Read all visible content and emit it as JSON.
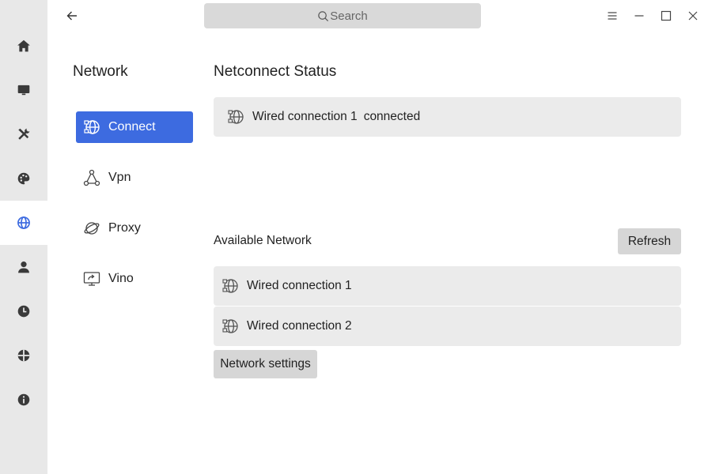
{
  "rail": {
    "items": [
      {
        "icon": "home-icon"
      },
      {
        "icon": "monitor-icon"
      },
      {
        "icon": "tools-icon"
      },
      {
        "icon": "palette-icon"
      },
      {
        "icon": "network-globe-icon",
        "active": true
      },
      {
        "icon": "user-icon"
      },
      {
        "icon": "clock-icon"
      },
      {
        "icon": "update-icon"
      },
      {
        "icon": "info-icon"
      }
    ]
  },
  "titlebar": {
    "search_placeholder": "Search"
  },
  "nav": {
    "title": "Network",
    "items": [
      {
        "label": "Connect",
        "active": true
      },
      {
        "label": "Vpn"
      },
      {
        "label": "Proxy"
      },
      {
        "label": "Vino"
      }
    ]
  },
  "main": {
    "status_heading": "Netconnect Status",
    "status": {
      "name": "Wired connection 1",
      "state": "connected"
    },
    "available_label": "Available Network",
    "refresh_label": "Refresh",
    "networks": [
      "Wired connection 1",
      "Wired connection 2"
    ],
    "settings_label": "Network settings"
  },
  "colors": {
    "accent": "#3d6be0",
    "rail_bg": "#e8e8e8",
    "card_bg": "#ebebeb",
    "button_bg": "#d6d6d6"
  }
}
